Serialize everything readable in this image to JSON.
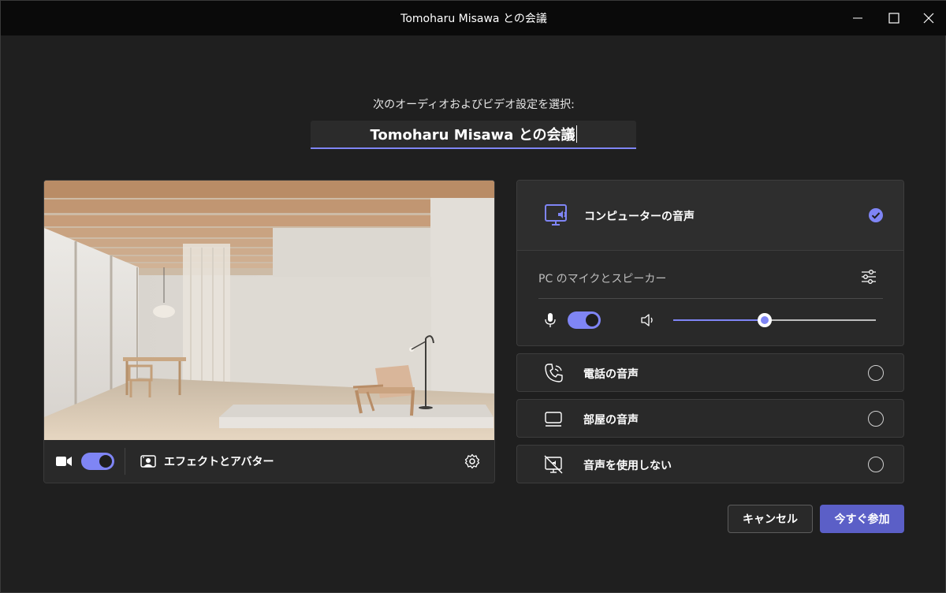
{
  "window": {
    "title": "Tomoharu Misawa との会議"
  },
  "header": {
    "subtitle": "次のオーディオおよびビデオ設定を選択:",
    "meeting_name": "Tomoharu Misawa との会議"
  },
  "video": {
    "camera_on": true,
    "effects_label": "エフェクトとアバター",
    "background_scene": "minimalist-room-with-wooden-beams"
  },
  "audio": {
    "options": [
      {
        "label": "コンピューターの音声",
        "icon": "computer-audio-icon",
        "selected": true
      },
      {
        "label": "電話の音声",
        "icon": "phone-audio-icon",
        "selected": false
      },
      {
        "label": "部屋の音声",
        "icon": "room-audio-icon",
        "selected": false
      },
      {
        "label": "音声を使用しない",
        "icon": "no-audio-icon",
        "selected": false
      }
    ],
    "device_label": "PC のマイクとスピーカー",
    "mic_on": true,
    "volume_percent": 45
  },
  "buttons": {
    "cancel": "キャンセル",
    "join": "今すぐ参加"
  },
  "colors": {
    "accent": "#7f85f5",
    "primary_button": "#5b5fc7",
    "background": "#1f1f1f",
    "titlebar": "#0a0a0a",
    "panel": "#292929"
  }
}
